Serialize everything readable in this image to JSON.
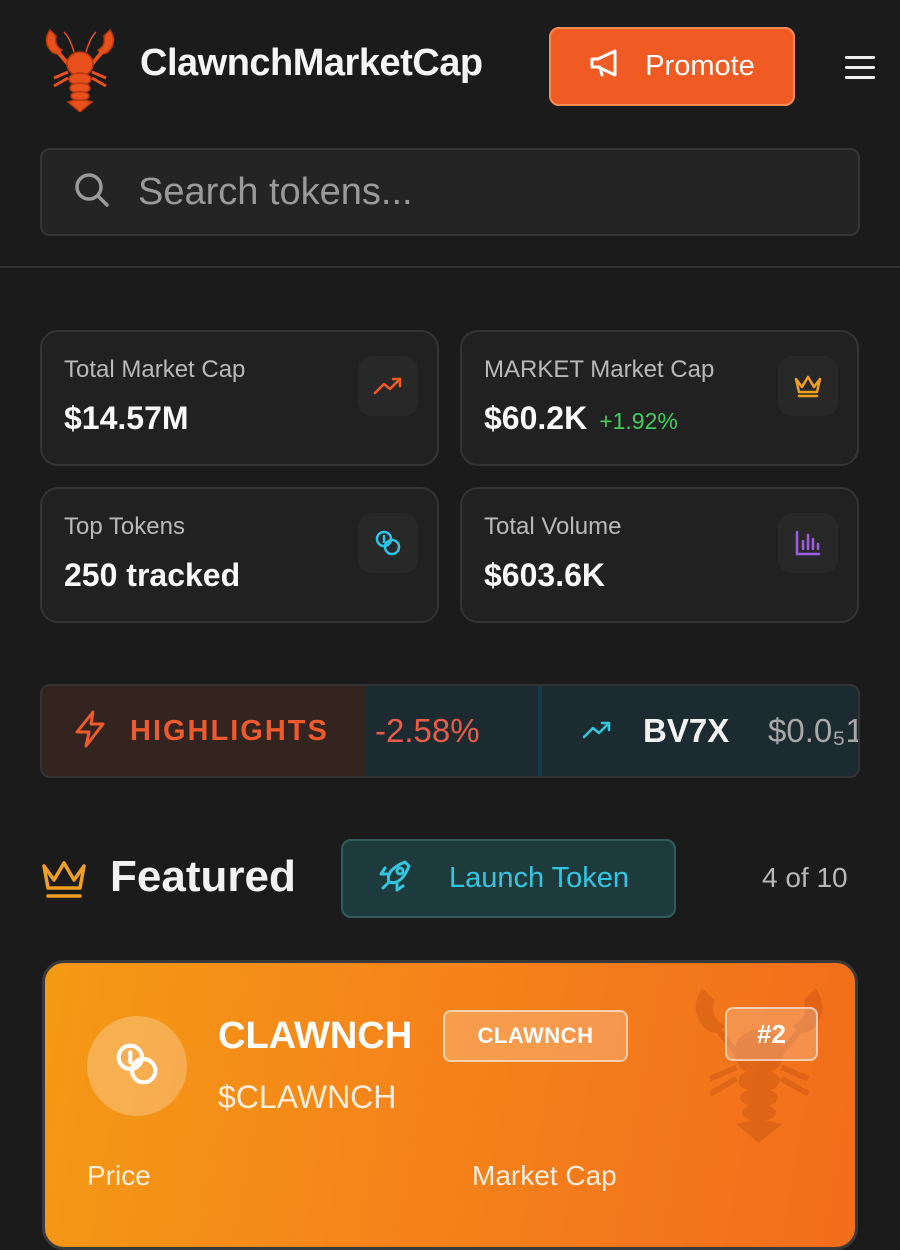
{
  "header": {
    "brand": "ClawnchMarketCap",
    "logo_icon": "lobster-icon",
    "promote_label": "Promote",
    "promote_icon": "megaphone-icon",
    "menu_icon": "hamburger-menu-icon"
  },
  "search": {
    "placeholder": "Search tokens...",
    "value": ""
  },
  "stats": [
    {
      "label": "Total Market Cap",
      "value": "$14.57M",
      "icon": "trending-up-icon",
      "icon_color": "#ef5b22"
    },
    {
      "label": "MARKET Market Cap",
      "value": "$60.2K",
      "delta": "+1.92%",
      "icon": "crown-icon",
      "icon_color": "#f0a020"
    },
    {
      "label": "Top Tokens",
      "value": "250 tracked",
      "icon": "coins-icon",
      "icon_color": "#2ec4e6"
    },
    {
      "label": "Total Volume",
      "value": "$603.6K",
      "icon": "bar-chart-icon",
      "icon_color": "#9b5de5"
    }
  ],
  "highlights": {
    "label": "HIGHLIGHTS",
    "icon": "lightning-icon",
    "items": [
      {
        "change": "-2.58%"
      },
      {
        "symbol": "BV7X",
        "price": "$0.0₅1",
        "icon": "trending-up-icon"
      }
    ]
  },
  "featured": {
    "title": "Featured",
    "icon": "crown-icon",
    "launch_label": "Launch Token",
    "launch_icon": "rocket-icon",
    "count": "4 of 10",
    "card": {
      "name": "CLAWNCH",
      "badge": "CLAWNCH",
      "rank": "#2",
      "ticker": "$CLAWNCH",
      "price_label": "Price",
      "mcap_label": "Market Cap",
      "avatar_icon": "coins-icon",
      "watermark_icon": "lobster-icon"
    }
  },
  "colors": {
    "background": "#1b1b1b",
    "accent": "#ef5b22",
    "positive": "#3fcf5b",
    "negative": "#e85c4a",
    "cyan": "#34c6e0"
  }
}
